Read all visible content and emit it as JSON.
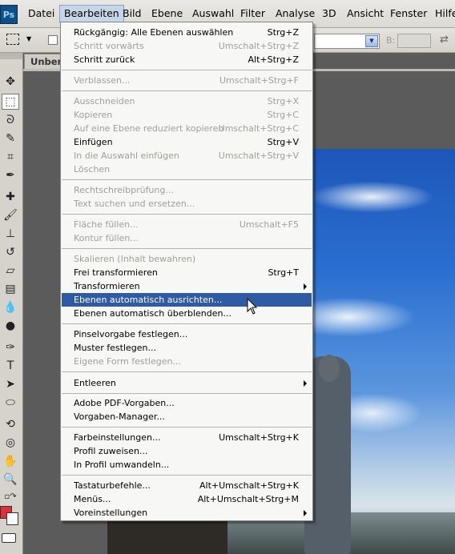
{
  "app": {
    "logo": "Ps"
  },
  "menubar": {
    "items": [
      "Datei",
      "Bearbeiten",
      "Bild",
      "Ebene",
      "Auswahl",
      "Filter",
      "Analyse",
      "3D",
      "Ansicht",
      "Fenster",
      "Hilfe"
    ],
    "active": "Bearbeiten"
  },
  "options": {
    "b_label": "B:"
  },
  "document": {
    "tab_title": "Unben"
  },
  "edit_menu": {
    "items": [
      {
        "label": "Rückgängig: Alle Ebenen auswählen",
        "shortcut": "Strg+Z",
        "enabled": true
      },
      {
        "label": "Schritt vorwärts",
        "shortcut": "Umschalt+Strg+Z",
        "enabled": false
      },
      {
        "label": "Schritt zurück",
        "shortcut": "Alt+Strg+Z",
        "enabled": true
      },
      {
        "label": "Verblassen...",
        "shortcut": "Umschalt+Strg+F",
        "enabled": false
      },
      {
        "label": "Ausschneiden",
        "shortcut": "Strg+X",
        "enabled": false
      },
      {
        "label": "Kopieren",
        "shortcut": "Strg+C",
        "enabled": false
      },
      {
        "label": "Auf eine Ebene reduziert kopieren",
        "shortcut": "Umschalt+Strg+C",
        "enabled": false
      },
      {
        "label": "Einfügen",
        "shortcut": "Strg+V",
        "enabled": true
      },
      {
        "label": "In die Auswahl einfügen",
        "shortcut": "Umschalt+Strg+V",
        "enabled": false
      },
      {
        "label": "Löschen",
        "shortcut": "",
        "enabled": false
      },
      {
        "label": "Rechtschreibprüfung...",
        "shortcut": "",
        "enabled": false
      },
      {
        "label": "Text suchen und ersetzen...",
        "shortcut": "",
        "enabled": false
      },
      {
        "label": "Fläche füllen...",
        "shortcut": "Umschalt+F5",
        "enabled": false
      },
      {
        "label": "Kontur füllen...",
        "shortcut": "",
        "enabled": false
      },
      {
        "label": "Skalieren (Inhalt bewahren)",
        "shortcut": "",
        "enabled": false
      },
      {
        "label": "Frei transformieren",
        "shortcut": "Strg+T",
        "enabled": true
      },
      {
        "label": "Transformieren",
        "shortcut": "",
        "enabled": true,
        "submenu": true
      },
      {
        "label": "Ebenen automatisch ausrichten...",
        "shortcut": "",
        "enabled": true,
        "highlighted": true
      },
      {
        "label": "Ebenen automatisch überblenden...",
        "shortcut": "",
        "enabled": true
      },
      {
        "label": "Pinselvorgabe festlegen...",
        "shortcut": "",
        "enabled": true
      },
      {
        "label": "Muster festlegen...",
        "shortcut": "",
        "enabled": true
      },
      {
        "label": "Eigene Form festlegen...",
        "shortcut": "",
        "enabled": false
      },
      {
        "label": "Entleeren",
        "shortcut": "",
        "enabled": true,
        "submenu": true
      },
      {
        "label": "Adobe PDF-Vorgaben...",
        "shortcut": "",
        "enabled": true
      },
      {
        "label": "Vorgaben-Manager...",
        "shortcut": "",
        "enabled": true
      },
      {
        "label": "Farbeinstellungen...",
        "shortcut": "Umschalt+Strg+K",
        "enabled": true
      },
      {
        "label": "Profil zuweisen...",
        "shortcut": "",
        "enabled": true
      },
      {
        "label": "In Profil umwandeln...",
        "shortcut": "",
        "enabled": true
      },
      {
        "label": "Tastaturbefehle...",
        "shortcut": "Alt+Umschalt+Strg+K",
        "enabled": true
      },
      {
        "label": "Menüs...",
        "shortcut": "Alt+Umschalt+Strg+M",
        "enabled": true
      },
      {
        "label": "Voreinstellungen",
        "shortcut": "",
        "enabled": true,
        "submenu": true
      }
    ]
  },
  "colors": {
    "foreground": "#e0313a",
    "background": "#ffffff",
    "menu_highlight": "#2f5aa4"
  }
}
